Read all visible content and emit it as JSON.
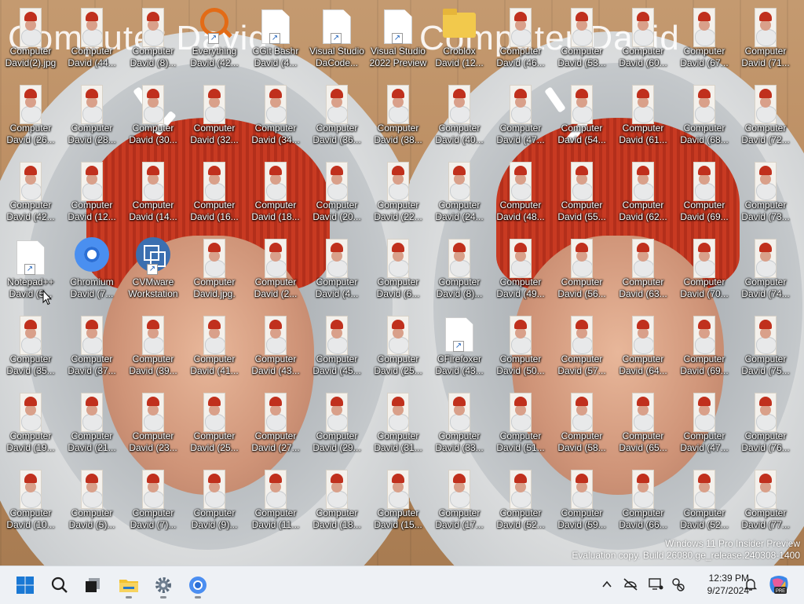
{
  "wallpaper": {
    "text_left": "Computer David",
    "text_right": "Computer David"
  },
  "icons": [
    {
      "label": "Computer\nDavid(2).jpg",
      "kind": "photo"
    },
    {
      "label": "Computer\nDavid (44...",
      "kind": "photo"
    },
    {
      "label": "Computer\nDavid (8)...",
      "kind": "photo"
    },
    {
      "label": "Everything\nDavid (42...",
      "kind": "everything"
    },
    {
      "label": "CGit Bashr\nDavid (4...",
      "kind": "doc"
    },
    {
      "label": "Visual Studio\nDaCode...",
      "kind": "doc"
    },
    {
      "label": "Visual Studio\n2022 Preview",
      "kind": "doc"
    },
    {
      "label": "Croblox\nDavid (12...",
      "kind": "folder"
    },
    {
      "label": "Computer\nDavid (46...",
      "kind": "photo"
    },
    {
      "label": "Computer\nDavid (53...",
      "kind": "photo"
    },
    {
      "label": "Computer\nDavid (60...",
      "kind": "photo"
    },
    {
      "label": "Computer\nDavid (67...",
      "kind": "photo"
    },
    {
      "label": "Computer\nDavid (71...",
      "kind": "photo"
    },
    {
      "label": "Computer\nDavid (26...",
      "kind": "photo"
    },
    {
      "label": "Computer\nDavid (28...",
      "kind": "photo"
    },
    {
      "label": "Computer\nDavid (30...",
      "kind": "photo"
    },
    {
      "label": "Computer\nDavid (32...",
      "kind": "photo"
    },
    {
      "label": "Computer\nDavid (34...",
      "kind": "photo"
    },
    {
      "label": "Computer\nDavid (36...",
      "kind": "photo"
    },
    {
      "label": "Computer\nDavid (38...",
      "kind": "photo"
    },
    {
      "label": "Computer\nDavid (40...",
      "kind": "photo"
    },
    {
      "label": "Computer\nDavid (47...",
      "kind": "photo"
    },
    {
      "label": "Computer\nDavid (54...",
      "kind": "photo"
    },
    {
      "label": "Computer\nDavid (61...",
      "kind": "photo"
    },
    {
      "label": "Computer\nDavid (68...",
      "kind": "photo"
    },
    {
      "label": "Computer\nDavid (72...",
      "kind": "photo"
    },
    {
      "label": "Computer\nDavid (42...",
      "kind": "photo"
    },
    {
      "label": "Computer\nDavid (12...",
      "kind": "photo"
    },
    {
      "label": "Computer\nDavid (14...",
      "kind": "photo"
    },
    {
      "label": "Computer\nDavid (16...",
      "kind": "photo"
    },
    {
      "label": "Computer\nDavid (18...",
      "kind": "photo"
    },
    {
      "label": "Computer\nDavid (20...",
      "kind": "photo"
    },
    {
      "label": "Computer\nDavid (22...",
      "kind": "photo"
    },
    {
      "label": "Computer\nDavid (24...",
      "kind": "photo"
    },
    {
      "label": "Computer\nDavid (48...",
      "kind": "photo"
    },
    {
      "label": "Computer\nDavid (55...",
      "kind": "photo"
    },
    {
      "label": "Computer\nDavid (62...",
      "kind": "photo"
    },
    {
      "label": "Computer\nDavid (69...",
      "kind": "photo"
    },
    {
      "label": "Computer\nDavid (73...",
      "kind": "photo"
    },
    {
      "label": "Notepad++\nDavid (5...",
      "kind": "doc"
    },
    {
      "label": "Chromium\nDavid (7...",
      "kind": "chromium"
    },
    {
      "label": "CVMware\nWorkstation",
      "kind": "vmware"
    },
    {
      "label": "Computer\nDavid.jpg.",
      "kind": "photo"
    },
    {
      "label": "Computer\nDavid (2...",
      "kind": "photo"
    },
    {
      "label": "Computer\nDavid (4...",
      "kind": "photo"
    },
    {
      "label": "Computer\nDavid (6...",
      "kind": "photo"
    },
    {
      "label": "Computer\nDavid (8)...",
      "kind": "photo"
    },
    {
      "label": "Computer\nDavid (49...",
      "kind": "photo"
    },
    {
      "label": "Computer\nDavid (56...",
      "kind": "photo"
    },
    {
      "label": "Computer\nDavid (63...",
      "kind": "photo"
    },
    {
      "label": "Computer\nDavid (70...",
      "kind": "photo"
    },
    {
      "label": "Computer\nDavid (74...",
      "kind": "photo"
    },
    {
      "label": "Computer\nDavid (35...",
      "kind": "photo"
    },
    {
      "label": "Computer\nDavid (37...",
      "kind": "photo"
    },
    {
      "label": "Computer\nDavid (39...",
      "kind": "photo"
    },
    {
      "label": "Computer\nDavid (41...",
      "kind": "photo"
    },
    {
      "label": "Computer\nDavid (43...",
      "kind": "photo"
    },
    {
      "label": "Computer\nDavid (45...",
      "kind": "photo"
    },
    {
      "label": "Computer\nDavid (25...",
      "kind": "photo"
    },
    {
      "label": "CFirefoxer\nDavid (43...",
      "kind": "doc"
    },
    {
      "label": "Computer\nDavid (50...",
      "kind": "photo"
    },
    {
      "label": "Computer\nDavid (57...",
      "kind": "photo"
    },
    {
      "label": "Computer\nDavid (64...",
      "kind": "photo"
    },
    {
      "label": "Computer\nDavid (69...",
      "kind": "photo"
    },
    {
      "label": "Computer\nDavid (75...",
      "kind": "photo"
    },
    {
      "label": "Computer\nDavid (19...",
      "kind": "photo"
    },
    {
      "label": "Computer\nDavid (21...",
      "kind": "photo"
    },
    {
      "label": "Computer\nDavid (23...",
      "kind": "photo"
    },
    {
      "label": "Computer\nDavid (25...",
      "kind": "photo"
    },
    {
      "label": "Computer\nDavid (27...",
      "kind": "photo"
    },
    {
      "label": "Computer\nDavid (29...",
      "kind": "photo"
    },
    {
      "label": "Computer\nDavid (31...",
      "kind": "photo"
    },
    {
      "label": "Computer\nDavid (33...",
      "kind": "photo"
    },
    {
      "label": "Computer\nDavid (51...",
      "kind": "photo"
    },
    {
      "label": "Computer\nDavid (58...",
      "kind": "photo"
    },
    {
      "label": "Computer\nDavid (65...",
      "kind": "photo"
    },
    {
      "label": "Computer\nDavid (47...",
      "kind": "photo"
    },
    {
      "label": "Computer\nDavid (76...",
      "kind": "photo"
    },
    {
      "label": "Computer\nDavid (10...",
      "kind": "photo"
    },
    {
      "label": "Computer\nDavid (5)...",
      "kind": "photo"
    },
    {
      "label": "Computer\nDavid (7)...",
      "kind": "photo"
    },
    {
      "label": "Computer\nDavid (9)...",
      "kind": "photo"
    },
    {
      "label": "Computer\nDavid (11...",
      "kind": "photo"
    },
    {
      "label": "Computer\nDavid (18...",
      "kind": "photo"
    },
    {
      "label": "Computer\nDavid (15...",
      "kind": "photo"
    },
    {
      "label": "Computer\nDavid (17...",
      "kind": "photo"
    },
    {
      "label": "Computer\nDavid (52...",
      "kind": "photo"
    },
    {
      "label": "Computer\nDavid (59...",
      "kind": "photo"
    },
    {
      "label": "Computer\nDavid (66...",
      "kind": "photo"
    },
    {
      "label": "Computer\nDavid (52...",
      "kind": "photo"
    },
    {
      "label": "Computer\nDavid (77...",
      "kind": "photo"
    }
  ],
  "watermark": {
    "line1": "Windows 11 Pro Insider Preview",
    "line2": "Evaluation copy. Build 26080.ge_release.240308-1400"
  },
  "taskbar": {
    "apps": [
      {
        "name": "start-button",
        "icon": "windows-logo-icon"
      },
      {
        "name": "search-button",
        "icon": "search-icon"
      },
      {
        "name": "task-view-button",
        "icon": "task-view-icon"
      },
      {
        "name": "file-explorer-button",
        "icon": "folder-icon"
      },
      {
        "name": "settings-button",
        "icon": "gear-icon"
      },
      {
        "name": "chromium-taskbar-button",
        "icon": "chromium-icon"
      }
    ],
    "tray": [
      "chevron-up-icon",
      "network-off-icon",
      "display-icon",
      "accessibility-icon"
    ],
    "time": "12:39 PM",
    "date": "9/27/2024"
  }
}
